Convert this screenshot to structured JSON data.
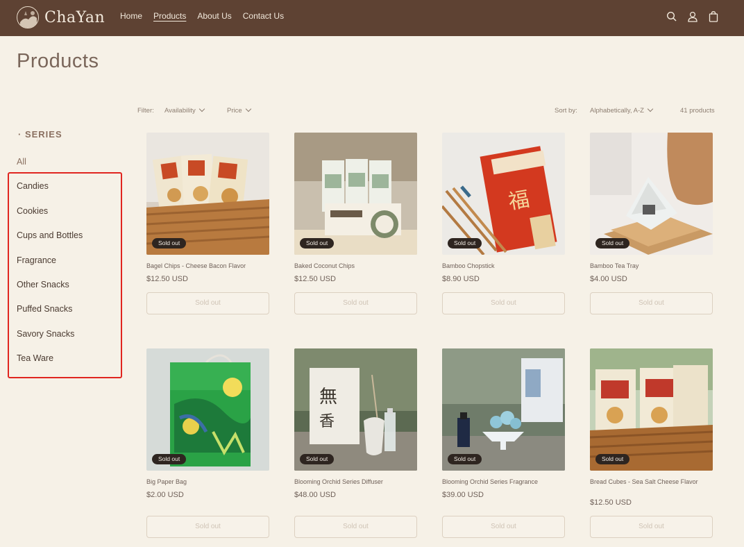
{
  "header": {
    "brand": "ChaYan",
    "nav": [
      "Home",
      "Products",
      "About Us",
      "Contact Us"
    ],
    "active_nav": "Products",
    "icons": [
      "search-icon",
      "account-icon",
      "cart-icon"
    ]
  },
  "page": {
    "title": "Products"
  },
  "sidebar": {
    "heading": "· SERIES",
    "items": [
      "All",
      "Candies",
      "Cookies",
      "Cups and Bottles",
      "Fragrance",
      "Other Snacks",
      "Puffed Snacks",
      "Savory Snacks",
      "Tea Ware"
    ]
  },
  "filter": {
    "label": "Filter:",
    "availability": "Availability",
    "price": "Price",
    "sort_label": "Sort by:",
    "sort_value": "Alphabetically, A-Z",
    "count": "41 products"
  },
  "products": [
    {
      "name": "Bagel Chips - Cheese Bacon Flavor",
      "price": "$12.50 USD",
      "badge": "Sold out",
      "button": "Sold out"
    },
    {
      "name": "Baked Coconut Chips",
      "price": "$12.50 USD",
      "badge": "Sold out",
      "button": "Sold out"
    },
    {
      "name": "Bamboo Chopstick",
      "price": "$8.90 USD",
      "badge": "Sold out",
      "button": "Sold out"
    },
    {
      "name": "Bamboo Tea Tray",
      "price": "$4.00 USD",
      "badge": "Sold out",
      "button": "Sold out"
    },
    {
      "name": "Big Paper Bag",
      "price": "$2.00 USD",
      "badge": "Sold out",
      "button": "Sold out"
    },
    {
      "name": "Blooming Orchid Series Diffuser",
      "price": "$48.00 USD",
      "badge": "Sold out",
      "button": "Sold out"
    },
    {
      "name": "Blooming Orchid Series Fragrance",
      "price": "$39.00 USD",
      "badge": "Sold out",
      "button": "Sold out"
    },
    {
      "name": "Bread Cubes - Sea Salt Cheese Flavor",
      "price": "$12.50 USD",
      "badge": "Sold out",
      "button": "Sold out"
    }
  ],
  "colors": {
    "header_bg": "#5e4233",
    "page_bg": "#f6f1e7",
    "badge_bg": "#2e2520",
    "highlight": "#e0251f"
  }
}
